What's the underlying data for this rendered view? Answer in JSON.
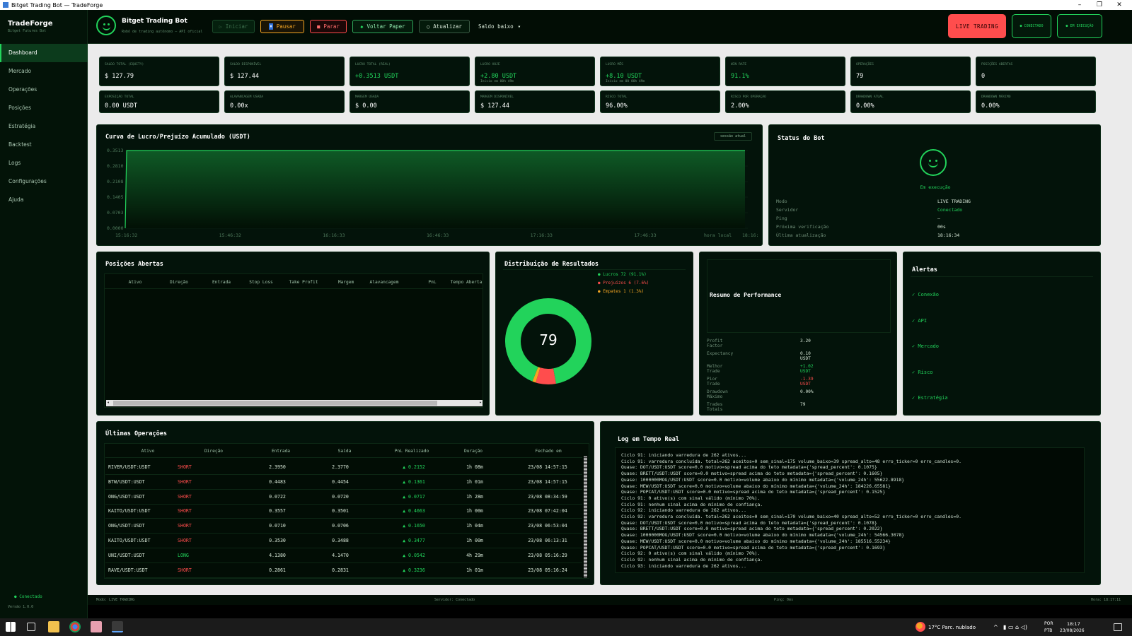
{
  "window": {
    "title": "Bitget Trading Bot — TradeForge",
    "controls": [
      "–",
      "❐",
      "✕"
    ]
  },
  "sidebar": {
    "brand": "TradeForge",
    "brand_sub": "Bitget Futures Bot",
    "items": [
      {
        "label": "Dashboard"
      },
      {
        "label": "Mercado"
      },
      {
        "label": "Operações"
      },
      {
        "label": "Posições"
      },
      {
        "label": "Estratégia"
      },
      {
        "label": "Backtest"
      },
      {
        "label": "Logs"
      },
      {
        "label": "Configurações"
      },
      {
        "label": "Ajuda"
      }
    ],
    "status": "● Conectado",
    "version": "Versão 1.0.0"
  },
  "topbar": {
    "title": "Bitget Trading Bot",
    "subtitle": "Robô de trading autônomo — API oficial",
    "buttons": {
      "start": "Iniciar",
      "pause": "Pausar",
      "stop": "Parar",
      "paper": "Voltar Paper",
      "refresh": "Atualizar"
    },
    "select": "Saldo baixo",
    "live": "LIVE TRADING",
    "connected": "● CONECTADO",
    "running": "● EM EXECUÇÃO"
  },
  "kpis_row1": [
    {
      "label": "Saldo Total (Equity)",
      "value": "$ 127.79",
      "sub": ""
    },
    {
      "label": "Saldo Disponível",
      "value": "$ 127.44",
      "sub": ""
    },
    {
      "label": "Lucro Total (Real)",
      "value": "+0.3513 USDT",
      "sub": ""
    },
    {
      "label": "Lucro Hoje",
      "value": "+2.80 USDT",
      "sub": "Início em 00h 49m"
    },
    {
      "label": "Lucro Mês",
      "value": "+8.10 USDT",
      "sub": "Início em 00 00h 49m"
    },
    {
      "label": "Win Rate",
      "value": "91.1%",
      "sub": ""
    },
    {
      "label": "Operações",
      "value": "79",
      "sub": ""
    },
    {
      "label": "Posições Abertas",
      "value": "0",
      "sub": ""
    }
  ],
  "kpis_row2": [
    {
      "label": "Exposição Total",
      "value": "0.00 USDT"
    },
    {
      "label": "Alavancagem Usada",
      "value": "0.00x"
    },
    {
      "label": "Margem Usada",
      "value": "$ 0.00"
    },
    {
      "label": "Margem Disponível",
      "value": "$ 127.44"
    },
    {
      "label": "Risco Total",
      "value": "96.00%"
    },
    {
      "label": "Risco por Operação",
      "value": "2.00%"
    },
    {
      "label": "Drawdown Atual",
      "value": "0.00%"
    },
    {
      "label": "Drawdown Máximo",
      "value": "0.00%"
    }
  ],
  "pnl_chart": {
    "title": "Curva de Lucro/Prejuízo Acumulado (USDT)",
    "tag": "sessão atual",
    "xlabel_suffix": "hora local",
    "colors": {
      "line": "#22d35b",
      "fill": "#0f5a26"
    }
  },
  "chart_data": {
    "type": "area",
    "title": "Curva de Lucro/Prejuízo Acumulado (USDT)",
    "xlabel": "hora local",
    "x_ticks": [
      "15:16:32",
      "15:46:32",
      "16:16:33",
      "16:46:33",
      "17:16:33",
      "17:46:33",
      "18:16:"
    ],
    "y_ticks": [
      "0.3513",
      "0.2810",
      "0.2108",
      "0.1405",
      "0.0703",
      "0.0000"
    ],
    "ylim": [
      0,
      0.3513
    ],
    "x": [
      "15:16:32",
      "15:16:33",
      "18:16:34"
    ],
    "values": [
      0,
      0.3513,
      0.3513
    ],
    "grid": true
  },
  "bot_status": {
    "title": "Status do Bot",
    "state": "Em execução",
    "rows": [
      {
        "k": "Modo",
        "v": "LIVE TRADING"
      },
      {
        "k": "Servidor",
        "v": "Conectado"
      },
      {
        "k": "Ping",
        "v": "—"
      },
      {
        "k": "Próxima verificação",
        "v": "00s"
      },
      {
        "k": "Última atualização",
        "v": "18:16:34"
      }
    ]
  },
  "positions": {
    "title": "Posições Abertas",
    "columns": [
      "Ativo",
      "Direção",
      "Entrada",
      "Stop Loss",
      "Take Profit",
      "Margem",
      "Alavancagem",
      "PnL",
      "Tempo Aberta"
    ]
  },
  "distribution": {
    "title": "Distribuição de Resultados",
    "total": "79",
    "legend": [
      {
        "label": "Lucros",
        "count": "72",
        "pct": "(91.1%)",
        "color": "#22d35b"
      },
      {
        "label": "Prejuízos",
        "count": "6",
        "pct": "(7.6%)",
        "color": "#ff4d4d"
      },
      {
        "label": "Empates",
        "count": "1",
        "pct": "(1.3%)",
        "color": "#f5a623"
      }
    ]
  },
  "performance": {
    "title": "Resumo de Performance",
    "rows": [
      {
        "k": "Profit Factor",
        "v": "3.20"
      },
      {
        "k": "Expectancy",
        "v": "0.10 USDT"
      },
      {
        "k": "Melhor Trade",
        "v": "+1.02 USDT"
      },
      {
        "k": "Pior Trade",
        "v": "-1.39 USDT"
      },
      {
        "k": "Drawdown Máximo",
        "v": "0.00%"
      },
      {
        "k": "Trades Totais",
        "v": "79"
      }
    ]
  },
  "alerts": {
    "title": "Alertas",
    "items": [
      "✓ Conexão",
      "✓ API",
      "✓ Mercado",
      "✓ Risco",
      "✓ Estratégia"
    ]
  },
  "trades": {
    "title": "Últimas Operações",
    "columns": [
      "Ativo",
      "Direção",
      "Entrada",
      "Saída",
      "PnL Realizado",
      "Duração",
      "Fechado em"
    ],
    "rows": [
      [
        "RIVER/USDT:USDT",
        "SHORT",
        "2.3950",
        "2.3770",
        "▲ 0.2152",
        "1h 08m",
        "23/08 14:57:15"
      ],
      [
        "BTW/USDT:USDT",
        "SHORT",
        "0.4483",
        "0.4454",
        "▲ 0.1361",
        "1h 01m",
        "23/08 14:57:15"
      ],
      [
        "ONG/USDT:USDT",
        "SHORT",
        "0.0722",
        "0.0720",
        "▲ 0.0717",
        "1h 28m",
        "23/08 08:34:59"
      ],
      [
        "KAITO/USDT:USDT",
        "SHORT",
        "0.3557",
        "0.3501",
        "▲ 0.4663",
        "1h 00m",
        "23/08 07:42:04"
      ],
      [
        "ONG/USDT:USDT",
        "SHORT",
        "0.0710",
        "0.0706",
        "▲ 0.1650",
        "1h 04m",
        "23/08 06:53:04"
      ],
      [
        "KAITO/USDT:USDT",
        "SHORT",
        "0.3530",
        "0.3488",
        "▲ 0.3477",
        "1h 00m",
        "23/08 06:13:31"
      ],
      [
        "UNI/USDT:USDT",
        "LONG",
        "4.1380",
        "4.1470",
        "▲ 0.0542",
        "4h 29m",
        "23/08 05:16:29"
      ],
      [
        "RAVE/USDT:USDT",
        "SHORT",
        "0.2861",
        "0.2831",
        "▲ 0.3236",
        "1h 01m",
        "23/08 05:16:24"
      ]
    ]
  },
  "log": {
    "title": "Log em Tempo Real",
    "lines": [
      "Ciclo 91: iniciando varredura de 262 ativos...",
      "Ciclo 91: varredura concluída. total=262 aceitos=0 sem_sinal=175 volume_baixo=39 spread_alto=48 erro_ticker=0 erro_candles=0.",
      "Quase: DOT/USDT:USDT score=0.0 motivo=spread acima do teto metadata={'spread_percent': 0.1075}",
      "Quase: BRETT/USDT:USDT score=0.0 motivo=spread acima do teto metadata={'spread_percent': 0.1605}",
      "Quase: 1000000MOG/USDT:USDT score=0.0 motivo=volume abaixo do mínimo metadata={'volume_24h': 55622.8918}",
      "Quase: MEW/USDT:USDT score=0.0 motivo=volume abaixo do mínimo metadata={'volume_24h': 184226.65581}",
      "Quase: POPCAT/USDT:USDT score=0.0 motivo=spread acima do teto metadata={'spread_percent': 0.1525}",
      "Ciclo 91: 0 ativo(s) com sinal válido (mínimo 70%).",
      "Ciclo 91: nenhum sinal acima do mínimo de confiança.",
      "Ciclo 92: iniciando varredura de 262 ativos...",
      "Ciclo 92: varredura concluída. total=262 aceitos=0 sem_sinal=170 volume_baixo=40 spread_alto=52 erro_ticker=0 erro_candles=0.",
      "Quase: DOT/USDT:USDT score=0.0 motivo=spread acima do teto metadata={'spread_percent': 0.1078}",
      "Quase: BRETT/USDT:USDT score=0.0 motivo=spread acima do teto metadata={'spread_percent': 0.2022}",
      "Quase: 1000000MOG/USDT:USDT score=0.0 motivo=volume abaixo do mínimo metadata={'volume_24h': 54566.3078}",
      "Quase: MEW/USDT:USDT score=0.0 motivo=volume abaixo do mínimo metadata={'volume_24h': 185516.55234}",
      "Quase: POPCAT/USDT:USDT score=0.0 motivo=spread acima do teto metadata={'spread_percent': 0.1693}",
      "Ciclo 92: 0 ativo(s) com sinal válido (mínimo 70%).",
      "Ciclo 92: nenhum sinal acima do mínimo de confiança.",
      "Ciclo 93: iniciando varredura de 262 ativos..."
    ]
  },
  "footer": {
    "mode": "Modo: LIVE TRADING",
    "server": "Servidor: Conectado",
    "ping": "Ping: 0ms",
    "time": "Hora: 18:17:11"
  },
  "taskbar": {
    "weather": "17°C  Parc. nublado",
    "lang1": "POR",
    "lang2": "PTB",
    "time": "18:17",
    "date": "23/08/2026"
  }
}
